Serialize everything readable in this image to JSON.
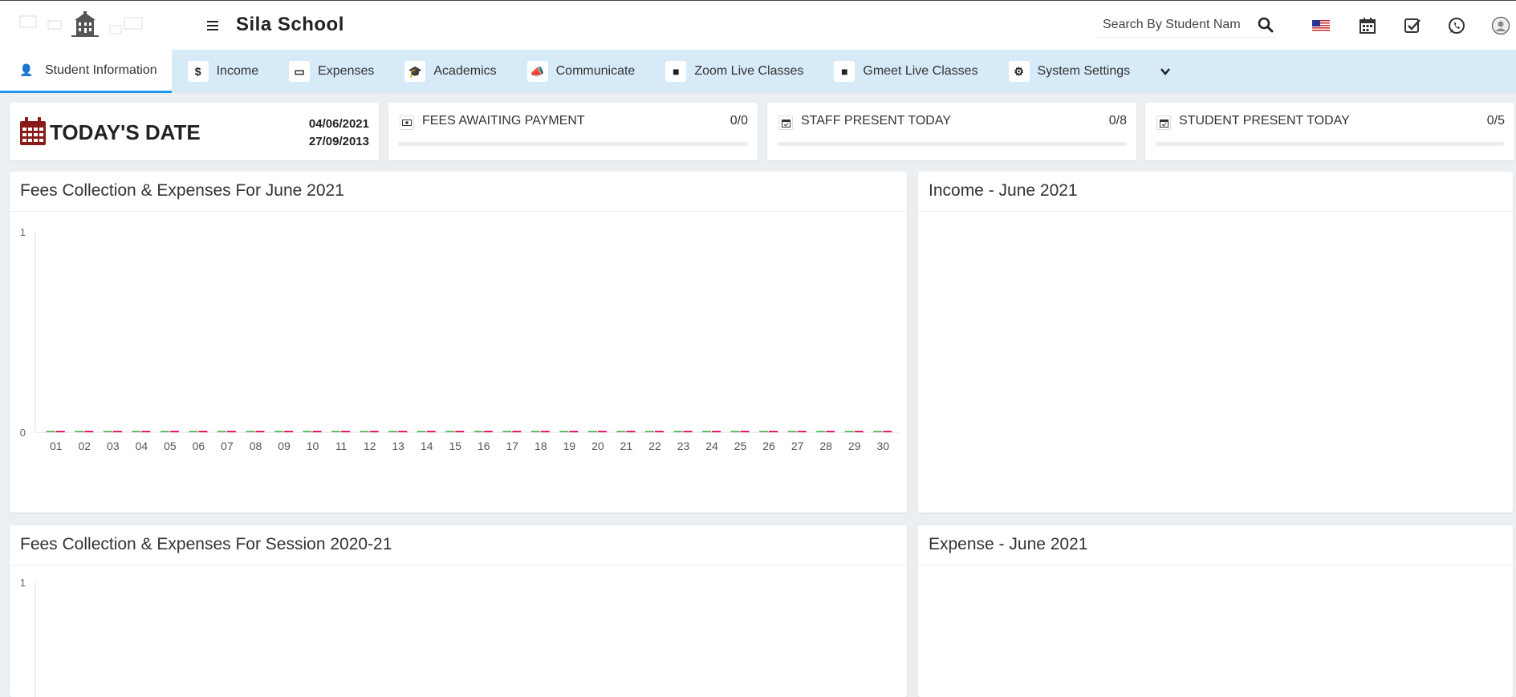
{
  "header": {
    "school_name": "Sila School",
    "search_placeholder": "Search By Student Name"
  },
  "nav": {
    "items": [
      {
        "label": "Student Information",
        "icon": "user-plus-icon",
        "glyph": "👤"
      },
      {
        "label": "Income",
        "icon": "dollar-icon",
        "glyph": "$"
      },
      {
        "label": "Expenses",
        "icon": "credit-card-icon",
        "glyph": "▭"
      },
      {
        "label": "Academics",
        "icon": "graduation-cap-icon",
        "glyph": "🎓"
      },
      {
        "label": "Communicate",
        "icon": "bullhorn-icon",
        "glyph": "📣"
      },
      {
        "label": "Zoom Live Classes",
        "icon": "video-icon",
        "glyph": "■"
      },
      {
        "label": "Gmeet Live Classes",
        "icon": "video-icon",
        "glyph": "■"
      },
      {
        "label": "System Settings",
        "icon": "cogs-icon",
        "glyph": "⚙"
      }
    ]
  },
  "today": {
    "title": "TODAY'S DATE",
    "date1": "04/06/2021",
    "date2": "27/09/2013"
  },
  "stats": [
    {
      "label": "FEES AWAITING PAYMENT",
      "value": "0/0",
      "progress": 0
    },
    {
      "label": "STAFF PRESENT TODAY",
      "value": "0/8",
      "progress": 0
    },
    {
      "label": "STUDENT PRESENT TODAY",
      "value": "0/5",
      "progress": 0
    }
  ],
  "panels": {
    "fees_month_title": "Fees Collection & Expenses For June 2021",
    "income_title": "Income - June 2021",
    "fees_session_title": "Fees Collection & Expenses For Session 2020-21",
    "expense_title": "Expense - June 2021"
  },
  "colors": {
    "accent": "#2196f3",
    "nav_bg": "#d7eaf8",
    "calendar": "#8b1a1a",
    "series_collection": "#66bb6a",
    "series_expenses": "#e91e63"
  },
  "chart_data": [
    {
      "type": "bar",
      "categories": [
        "01",
        "02",
        "03",
        "04",
        "05",
        "06",
        "07",
        "08",
        "09",
        "10",
        "11",
        "12",
        "13",
        "14",
        "15",
        "16",
        "17",
        "18",
        "19",
        "20",
        "21",
        "22",
        "23",
        "24",
        "25",
        "26",
        "27",
        "28",
        "29",
        "30"
      ],
      "series": [
        {
          "values": [
            0,
            0,
            0,
            0,
            0,
            0,
            0,
            0,
            0,
            0,
            0,
            0,
            0,
            0,
            0,
            0,
            0,
            0,
            0,
            0,
            0,
            0,
            0,
            0,
            0,
            0,
            0,
            0,
            0,
            0
          ],
          "color": "#66bb6a"
        },
        {
          "values": [
            0,
            0,
            0,
            0,
            0,
            0,
            0,
            0,
            0,
            0,
            0,
            0,
            0,
            0,
            0,
            0,
            0,
            0,
            0,
            0,
            0,
            0,
            0,
            0,
            0,
            0,
            0,
            0,
            0,
            0
          ],
          "color": "#e91e63"
        }
      ],
      "yticks": [
        "0",
        "1"
      ],
      "ylim": [
        0,
        1
      ]
    },
    {
      "type": "bar",
      "yticks": [
        "1"
      ],
      "ylim": [
        0,
        1
      ]
    }
  ]
}
